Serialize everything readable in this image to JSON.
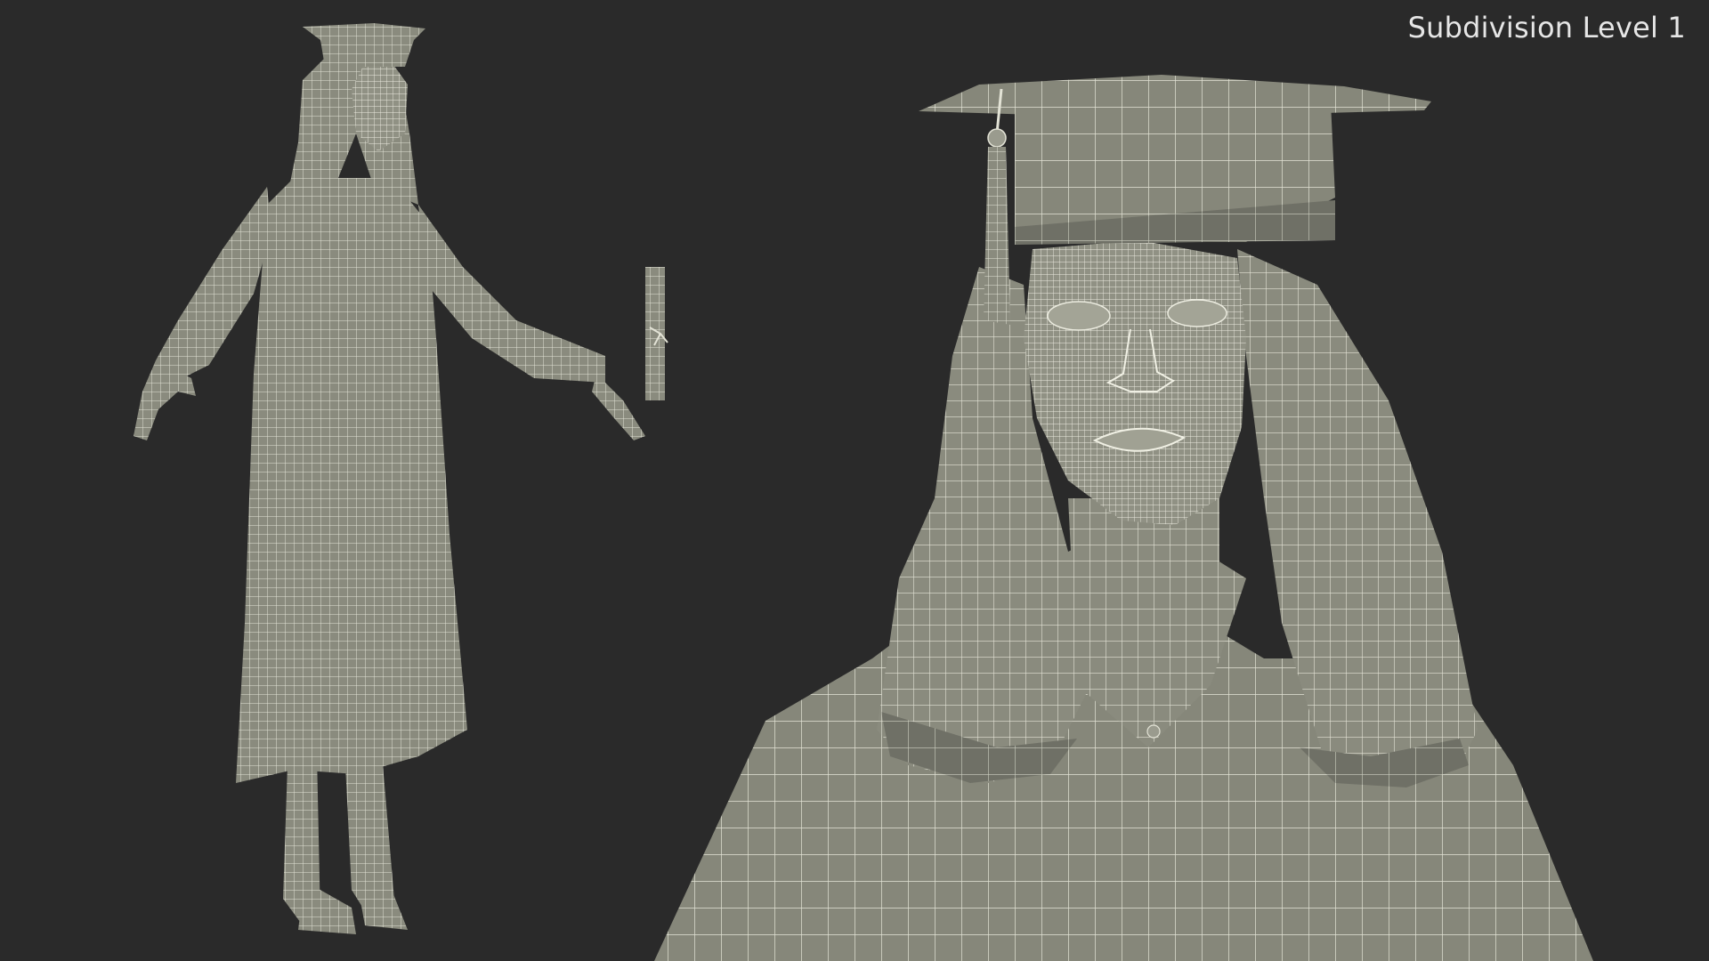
{
  "render": {
    "label": "Subdivision Level 1"
  },
  "colors": {
    "background": "#2a2a2a",
    "mesh_fill": "#8a8b7e",
    "mesh_shadow": "#6e6f64",
    "wire": "#e3e3d6"
  }
}
